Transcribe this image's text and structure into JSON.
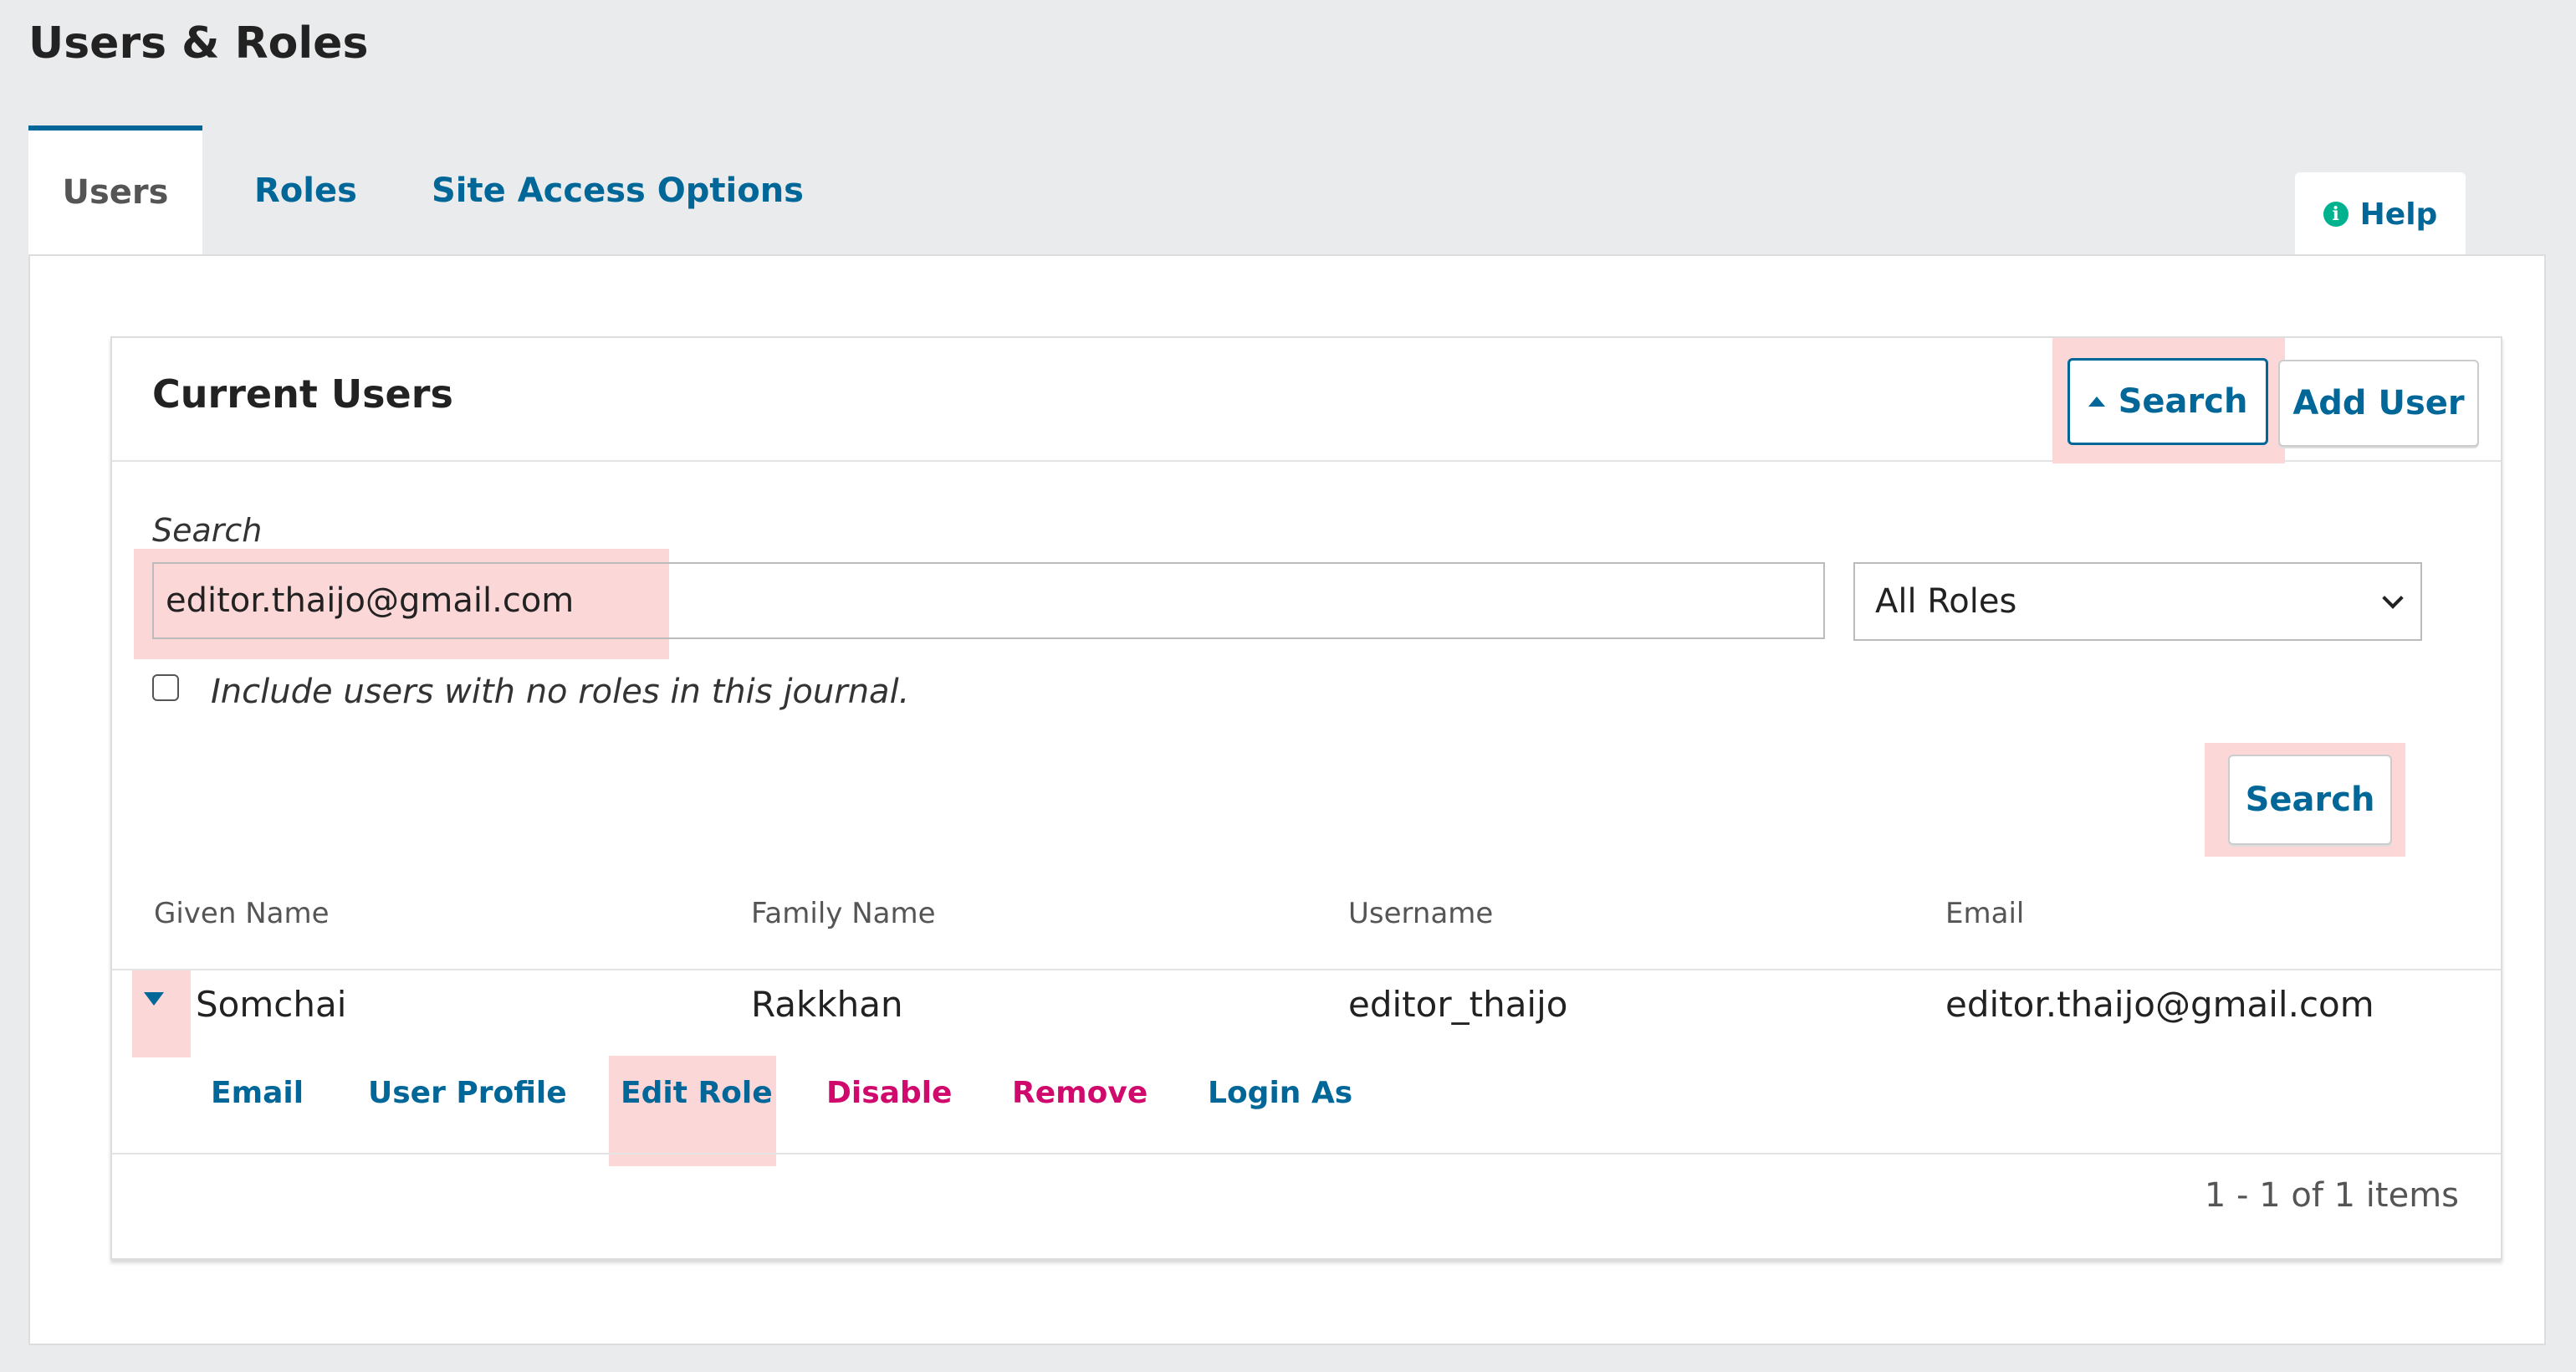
{
  "page": {
    "title": "Users & Roles"
  },
  "tabs": [
    {
      "label": "Users",
      "active": true
    },
    {
      "label": "Roles",
      "active": false
    },
    {
      "label": "Site Access Options",
      "active": false
    }
  ],
  "help": {
    "label": "Help",
    "icon": "info-icon"
  },
  "panel": {
    "title": "Current Users",
    "toggle_search_label": "Search",
    "add_user_label": "Add User"
  },
  "search": {
    "label": "Search",
    "value": "editor.thaijo@gmail.com",
    "role_filter": "All Roles",
    "include_no_roles_label": "Include users with no roles in this journal.",
    "include_no_roles_checked": false,
    "submit_label": "Search"
  },
  "table": {
    "columns": [
      "Given Name",
      "Family Name",
      "Username",
      "Email"
    ],
    "rows": [
      {
        "given_name": "Somchai",
        "family_name": "Rakkhan",
        "username": "editor_thaijo",
        "email": "editor.thaijo@gmail.com"
      }
    ],
    "row_actions": [
      "Email",
      "User Profile",
      "Edit Role",
      "Disable",
      "Remove",
      "Login As"
    ],
    "pagination": "1 - 1 of 1 items"
  },
  "colors": {
    "accent": "#006798",
    "danger": "#d00a6c",
    "highlight": "#fbd7d8",
    "info_icon": "#00b28d"
  }
}
